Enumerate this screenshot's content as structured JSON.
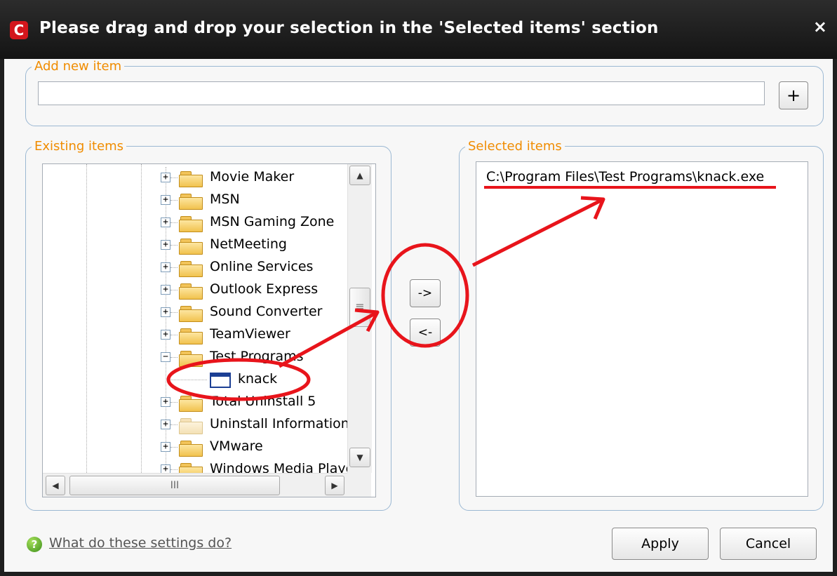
{
  "window": {
    "title": "Please drag and drop your selection in the 'Selected items' section",
    "app_icon_letter": "C",
    "close_glyph": "×"
  },
  "add_new": {
    "legend": "Add new item",
    "input_value": "",
    "add_label": "+"
  },
  "existing": {
    "legend": "Existing items",
    "nodes": [
      {
        "label": "Movie Maker",
        "expander": "+"
      },
      {
        "label": "MSN",
        "expander": "+"
      },
      {
        "label": "MSN Gaming Zone",
        "expander": "+"
      },
      {
        "label": "NetMeeting",
        "expander": "+"
      },
      {
        "label": "Online Services",
        "expander": "+"
      },
      {
        "label": "Outlook Express",
        "expander": "+"
      },
      {
        "label": "Sound Converter",
        "expander": "+"
      },
      {
        "label": "TeamViewer",
        "expander": "+"
      },
      {
        "label": "Test Programs",
        "expander": "−"
      },
      {
        "label": "knack",
        "type": "file"
      },
      {
        "label": "Total Uninstall 5",
        "expander": "+"
      },
      {
        "label": "Uninstall Information",
        "expander": "+"
      },
      {
        "label": "VMware",
        "expander": "+"
      },
      {
        "label": "Windows Media Player",
        "expander": "+"
      }
    ],
    "scroll_up": "▲",
    "scroll_down": "▼",
    "scroll_left": "◀",
    "scroll_right": "▶",
    "vthumb_grip": "≡",
    "hthumb_grip": "III"
  },
  "move": {
    "right_label": "->",
    "left_label": "<-"
  },
  "selected": {
    "legend": "Selected items",
    "items": [
      "C:\\Program Files\\Test Programs\\knack.exe"
    ]
  },
  "footer": {
    "help_text": "What do these settings do?",
    "help_icon": "?",
    "apply_label": "Apply",
    "cancel_label": "Cancel"
  },
  "colors": {
    "legend": "#f08c00",
    "annotation": "#e8141b",
    "titlebar": "#1f1f1f"
  }
}
